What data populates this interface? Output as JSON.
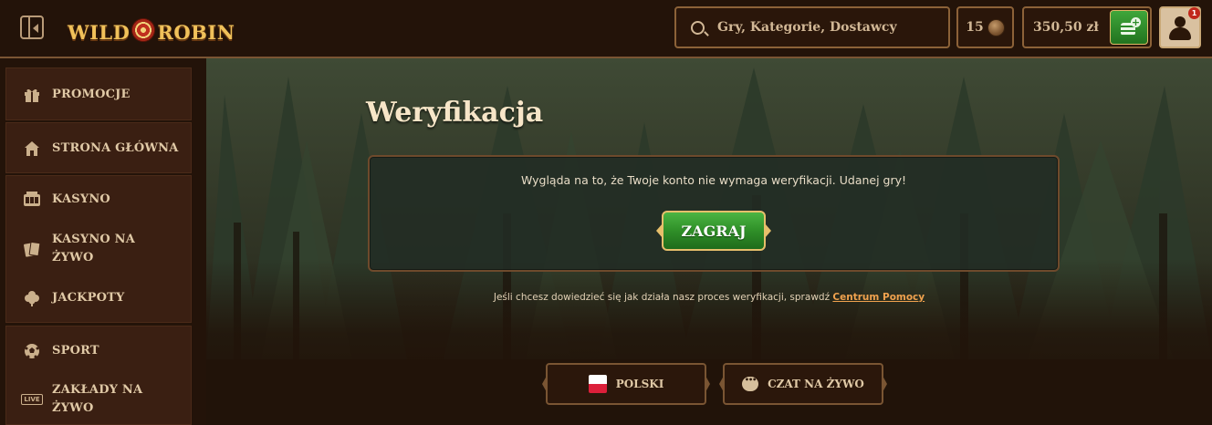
{
  "header": {
    "logo_text_left": "WILD",
    "logo_text_right": "ROBIN",
    "search_placeholder": "Gry, Kategorie, Dostawcy",
    "coins_count": "15",
    "balance": "350,50 zł",
    "notification_count": "1"
  },
  "sidebar": {
    "items": [
      {
        "label": "PROMOCJE",
        "icon": "gift-icon"
      },
      {
        "label": "STRONA GŁÓWNA",
        "icon": "home-icon"
      },
      {
        "label": "KASYNO",
        "icon": "slot-machine-icon"
      },
      {
        "label_line1": "KASYNO NA",
        "label_line2": "ŻYWO",
        "icon": "cards-icon"
      },
      {
        "label": "JACKPOTY",
        "icon": "clover-icon"
      },
      {
        "label": "SPORT",
        "icon": "soccer-ball-icon"
      },
      {
        "label_line1": "ZAKŁADY NA",
        "label_line2": "ŻYWO",
        "icon": "live-icon",
        "icon_text": "LIVE"
      }
    ]
  },
  "main": {
    "title": "Weryfikacja",
    "message": "Wygląda na to, że Twoje konto nie wymaga weryfikacji. Udanej gry!",
    "play_button": "ZAGRAJ",
    "help_text": "Jeśli chcesz dowiedzieć się jak działa nasz proces weryfikacji, sprawdź",
    "help_link": "Centrum Pomocy",
    "language_button": "POLSKI",
    "chat_button": "CZAT NA ŻYWO"
  },
  "colors": {
    "accent_gold": "#e6bf6b",
    "play_green": "#2f8f28",
    "link_orange": "#f0a24e",
    "sidebar_bg": "#3a1f12"
  }
}
